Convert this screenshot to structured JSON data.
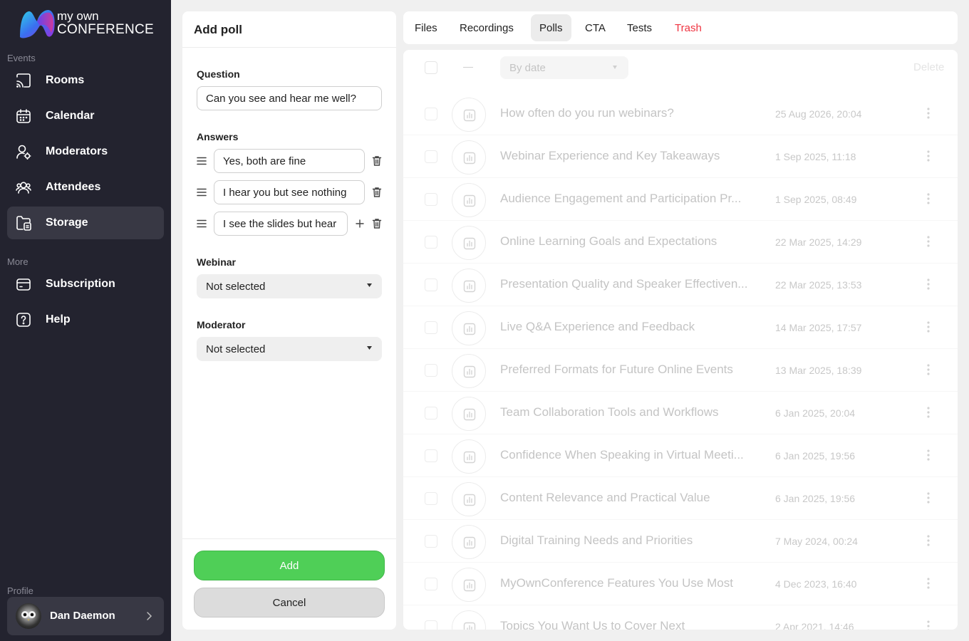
{
  "sidebar": {
    "logo_line1": "my own",
    "logo_line2": "CONFERENCE",
    "events_label": "Events",
    "more_label": "More",
    "profile_label": "Profile",
    "items": [
      {
        "label": "Rooms",
        "icon": "cast-icon"
      },
      {
        "label": "Calendar",
        "icon": "calendar-icon"
      },
      {
        "label": "Moderators",
        "icon": "moderator-icon"
      },
      {
        "label": "Attendees",
        "icon": "attendees-icon"
      },
      {
        "label": "Storage",
        "icon": "folder-icon"
      },
      {
        "label": "Subscription",
        "icon": "card-icon"
      },
      {
        "label": "Help",
        "icon": "help-icon"
      }
    ],
    "profile_name": "Dan Daemon"
  },
  "form": {
    "title": "Add poll",
    "question_label": "Question",
    "question_value": "Can you see and hear me well?",
    "answers_label": "Answers",
    "answers": [
      "Yes, both are fine",
      "I hear you but see nothing",
      "I see the slides but hear"
    ],
    "webinar_label": "Webinar",
    "webinar_value": "Not selected",
    "moderator_label": "Moderator",
    "moderator_value": "Not selected",
    "add_label": "Add",
    "cancel_label": "Cancel"
  },
  "tabs": [
    "Files",
    "Recordings",
    "Polls",
    "CTA",
    "Tests",
    "Trash"
  ],
  "active_tab": "Polls",
  "list": {
    "sort_label": "By date",
    "delete_label": "Delete",
    "polls": [
      {
        "title": "How often do you run webinars?",
        "date": "25 Aug 2026, 20:04"
      },
      {
        "title": "Webinar Experience and Key Takeaways",
        "date": "1 Sep 2025, 11:18"
      },
      {
        "title": "Audience Engagement and Participation Pr...",
        "date": "1 Sep 2025, 08:49"
      },
      {
        "title": "Online Learning Goals and Expectations",
        "date": "22 Mar 2025, 14:29"
      },
      {
        "title": "Presentation Quality and Speaker Effectiven...",
        "date": "22 Mar 2025, 13:53"
      },
      {
        "title": "Live Q&A Experience and Feedback",
        "date": "14 Mar 2025, 17:57"
      },
      {
        "title": "Preferred Formats for Future Online Events",
        "date": "13 Mar 2025, 18:39"
      },
      {
        "title": "Team Collaboration Tools and Workflows",
        "date": "6 Jan 2025, 20:04"
      },
      {
        "title": "Confidence When Speaking in Virtual Meeti...",
        "date": "6 Jan 2025, 19:56"
      },
      {
        "title": "Content Relevance and Practical Value",
        "date": "6 Jan 2025, 19:56"
      },
      {
        "title": "Digital Training Needs and Priorities",
        "date": "7 May 2024, 00:24"
      },
      {
        "title": "MyOwnConference Features You Use Most",
        "date": "4 Dec 2023, 16:40"
      },
      {
        "title": "Topics You Want Us to Cover Next",
        "date": "2 Apr 2021, 14:46"
      }
    ]
  },
  "colors": {
    "sidebar_bg": "#23232f",
    "accent_green": "#4fcf57",
    "trash_red": "#ef3340"
  }
}
